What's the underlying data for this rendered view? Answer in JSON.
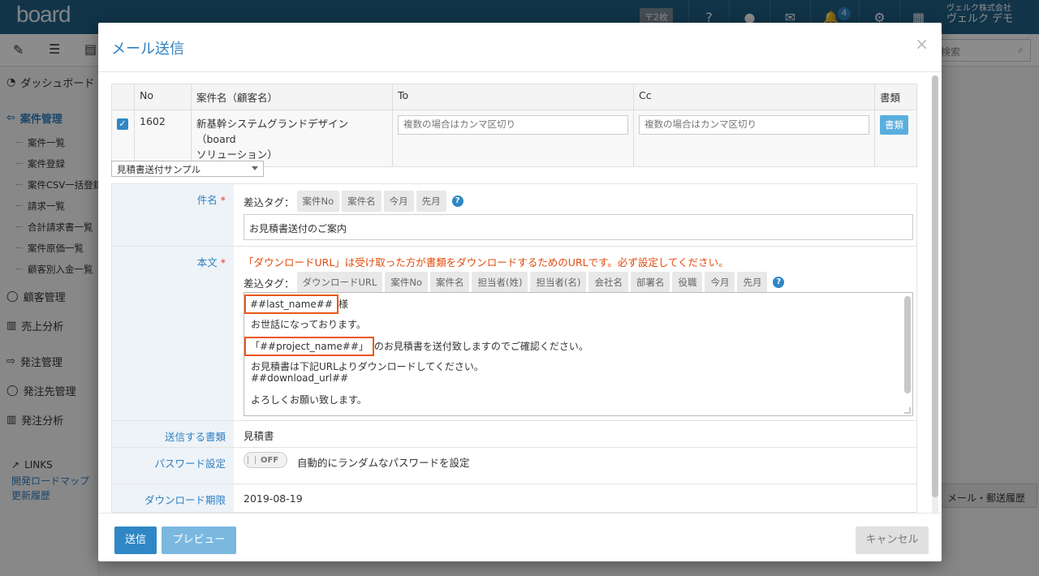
{
  "app": {
    "logo": "board",
    "stamps": "〒2枚",
    "notify_count": "4",
    "company": "ヴェルク株式会社",
    "user": "ヴェルク デモ",
    "search_placeholder": "検索",
    "bg_button": "メール・郵送履歴"
  },
  "sidebar": {
    "dashboard": "ダッシュボード",
    "project_mgmt": "案件管理",
    "sub": [
      "案件一覧",
      "案件登録",
      "案件CSV一括登録",
      "請求一覧",
      "合計請求書一覧",
      "案件原価一覧",
      "顧客別入金一覧"
    ],
    "customers": "顧客管理",
    "sales_analysis": "売上分析",
    "orders": "発注管理",
    "suppliers": "発注先管理",
    "order_analysis": "発注分析",
    "links": "LINKS",
    "roadmap": "開発ロードマップ",
    "changelog": "更新履歴"
  },
  "modal": {
    "title": "メール送信",
    "close": "×",
    "table": {
      "headers": [
        "No",
        "案件名（顧客名）",
        "To",
        "Cc",
        "書類"
      ],
      "row": {
        "no": "1602",
        "name_line1": "新基幹システムグランドデザイン（board",
        "name_line2": "ソリューション）",
        "to_placeholder": "複数の場合はカンマ区切り",
        "cc_placeholder": "複数の場合はカンマ区切り",
        "doc_button": "書類"
      }
    },
    "template": "見積書送付サンプル",
    "subject": {
      "label": "件名",
      "tags_label": "差込タグ：",
      "tags": [
        "案件No",
        "案件名",
        "今月",
        "先月"
      ],
      "value": "お見積書送付のご案内"
    },
    "body": {
      "label": "本文",
      "warning": "「ダウンロードURL」は受け取った方が書類をダウンロードするためのURLです。必ず設定してください。",
      "tags_label": "差込タグ：",
      "tags": [
        "ダウンロードURL",
        "案件No",
        "案件名",
        "担当者(姓)",
        "担当者(名)",
        "会社名",
        "部署名",
        "役職",
        "今月",
        "先月"
      ],
      "line1_hl": "##last_name##",
      "line1_rest": "様",
      "line2": "お世話になっております。",
      "line3_hl": "「##project_name##」",
      "line3_rest": "のお見積書を送付致しますのでご確認ください。",
      "line4": "お見積書は下記URLよりダウンロードしてください。",
      "line5": "##download_url##",
      "line6": "よろしくお願い致します。"
    },
    "docs": {
      "label": "送信する書類",
      "value": "見積書"
    },
    "password": {
      "label": "パスワード設定",
      "toggle": "OFF",
      "desc": "自動的にランダムなパスワードを設定"
    },
    "expiry": {
      "label": "ダウンロード期限",
      "value": "2019-08-19"
    },
    "footer": {
      "send": "送信",
      "preview": "プレビュー",
      "cancel": "キャンセル"
    }
  }
}
